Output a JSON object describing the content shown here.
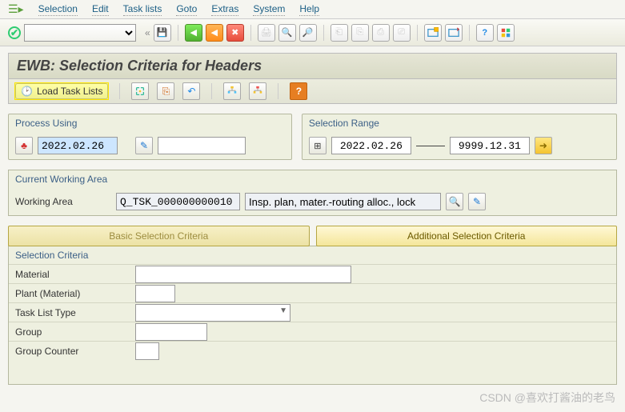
{
  "menu": {
    "items": [
      "Selection",
      "Edit",
      "Task lists",
      "Goto",
      "Extras",
      "System",
      "Help"
    ]
  },
  "title": "EWB: Selection Criteria for Headers",
  "appToolbar": {
    "loadTaskLists": "Load Task Lists"
  },
  "processUsing": {
    "title": "Process Using",
    "keyDate": "2022.02.26",
    "changeNo": ""
  },
  "selectionRange": {
    "title": "Selection Range",
    "from": "2022.02.26",
    "to": "9999.12.31"
  },
  "workingArea": {
    "panelTitle": "Current Working Area",
    "label": "Working Area",
    "id": "Q_TSK_000000000010",
    "desc": "Insp. plan, mater.-routing alloc., lock"
  },
  "tabs": {
    "basic": "Basic Selection Criteria",
    "additional": "Additional Selection Criteria"
  },
  "selectionCriteria": {
    "title": "Selection Criteria",
    "materialLabel": "Material",
    "material": "",
    "plantLabel": "Plant (Material)",
    "plant": "",
    "taskTypeLabel": "Task List Type",
    "taskType": "",
    "groupLabel": "Group",
    "group": "",
    "counterLabel": "Group Counter",
    "counter": ""
  },
  "watermark": "CSDN @喜欢打酱油的老鸟"
}
